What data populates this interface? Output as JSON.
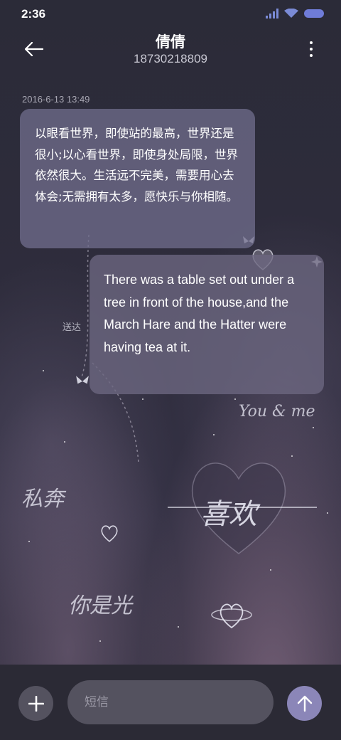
{
  "status_bar": {
    "time": "2:36"
  },
  "header": {
    "contact_name": "倩倩",
    "contact_number": "18730218809",
    "back_icon": "arrow-left-icon",
    "more_icon": "more-vertical-icon"
  },
  "conversation": {
    "timestamp": "2016-6-13 13:49",
    "incoming_message": "以眼看世界，即使站的最高，世界还是很小;以心看世界，即使身处局限，世界依然很大。生活远不完美，需要用心去体会;无需拥有太多，愿快乐与你相随。",
    "outgoing_message": "There was a table set out under a tree in front of the house,and the March Hare and the Hatter were having tea at it.",
    "delivered_label": "送达"
  },
  "wallpaper": {
    "text_you_me": "You & me",
    "text_1": "私奔",
    "text_2": "喜欢",
    "text_3": "你是光"
  },
  "input_bar": {
    "placeholder": "短信",
    "add_icon": "plus-icon",
    "send_icon": "arrow-up-icon"
  },
  "colors": {
    "accent": "#8b86b8",
    "battery": "#6f7cd8"
  }
}
